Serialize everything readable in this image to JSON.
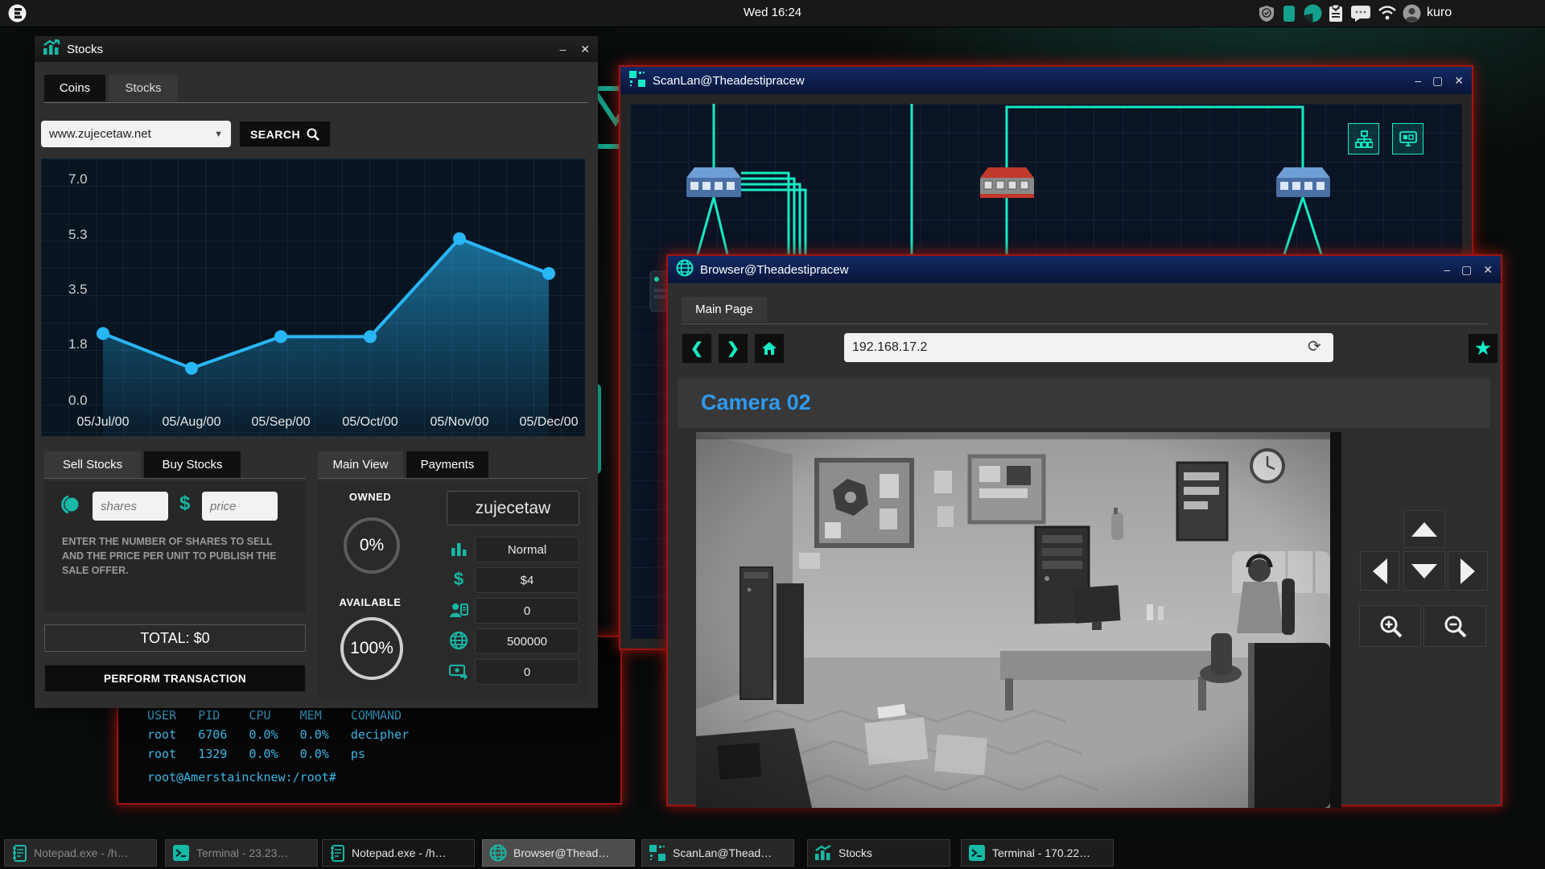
{
  "window_controls": {
    "minimize": "–",
    "maximize": "▢",
    "close": "✕"
  },
  "topbar": {
    "clock": "Wed 16:24",
    "username": "kuro"
  },
  "stocks": {
    "title": "Stocks",
    "tabs": [
      {
        "label": "Coins"
      },
      {
        "label": "Stocks"
      }
    ],
    "search": {
      "value": "www.zujecetaw.net",
      "button_label": "SEARCH"
    },
    "chart_data": {
      "type": "line",
      "title": "",
      "x": [
        "05/Jul/00",
        "05/Aug/00",
        "05/Sep/00",
        "05/Oct/00",
        "05/Nov/00",
        "05/Dec/00"
      ],
      "values": [
        2.1,
        1.0,
        2.0,
        2.0,
        5.1,
        4.0
      ],
      "y_ticks": [
        "7.0",
        "5.3",
        "3.5",
        "1.8",
        "0.0"
      ],
      "ylim": [
        0,
        7
      ],
      "grid": true,
      "legend": "none",
      "line_color": "#29b6f6"
    },
    "trade_tabs": [
      {
        "label": "Sell Stocks"
      },
      {
        "label": "Buy Stocks"
      }
    ],
    "sell_form": {
      "shares_placeholder": "shares",
      "price_placeholder": "price",
      "dollar_sign": "$",
      "help_text": "ENTER THE NUMBER OF SHARES TO SELL AND THE PRICE PER UNIT TO PUBLISH THE SALE OFFER.",
      "total_label": "TOTAL: $0",
      "submit_label": "PERFORM TRANSACTION"
    },
    "view_tabs": [
      {
        "label": "Main View"
      },
      {
        "label": "Payments"
      }
    ],
    "overview": {
      "owned_label": "OWNED",
      "owned_value": "0%",
      "available_label": "AVAILABLE",
      "available_value": "100%",
      "stock_name": "zujecetaw",
      "rows": [
        {
          "icon": "bar-chart",
          "value": "Normal"
        },
        {
          "icon": "dollar",
          "value": "$4"
        },
        {
          "icon": "shareholders",
          "value": "0"
        },
        {
          "icon": "globe",
          "value": "500000"
        },
        {
          "icon": "exchange",
          "value": "0"
        }
      ]
    }
  },
  "scanlan": {
    "title": "ScanLan@Theadestipracew"
  },
  "browser": {
    "title": "Browser@Theadestipracew",
    "tab_label": "Main Page",
    "url": "192.168.17.2",
    "page_heading": "Camera 02"
  },
  "terminal": {
    "lines": [
      "USER   PID    CPU    MEM    COMMAND",
      "root   6706   0.0%   0.0%   decipher",
      "root   1329   0.0%   0.0%   ps"
    ],
    "prompt": "root@Amerstaincknew:/root#"
  },
  "taskbar": {
    "items": [
      {
        "icon": "notepad",
        "label": "Notepad.exe - /h…"
      },
      {
        "icon": "terminal",
        "label": "Terminal - 23.23…"
      },
      {
        "icon": "notepad",
        "label": "Notepad.exe - /h…"
      },
      {
        "icon": "browser",
        "label": "Browser@Thead…"
      },
      {
        "icon": "scanlan",
        "label": "ScanLan@Thead…"
      },
      {
        "icon": "stocks",
        "label": "Stocks"
      },
      {
        "icon": "terminal",
        "label": "Terminal - 170.22…"
      }
    ]
  },
  "colors": {
    "accent_teal": "#17eac4",
    "icon_teal": "#17b8a6",
    "chart_blue": "#29b6f6",
    "heading_blue": "#2e9af0",
    "alert_red": "#a11510"
  }
}
